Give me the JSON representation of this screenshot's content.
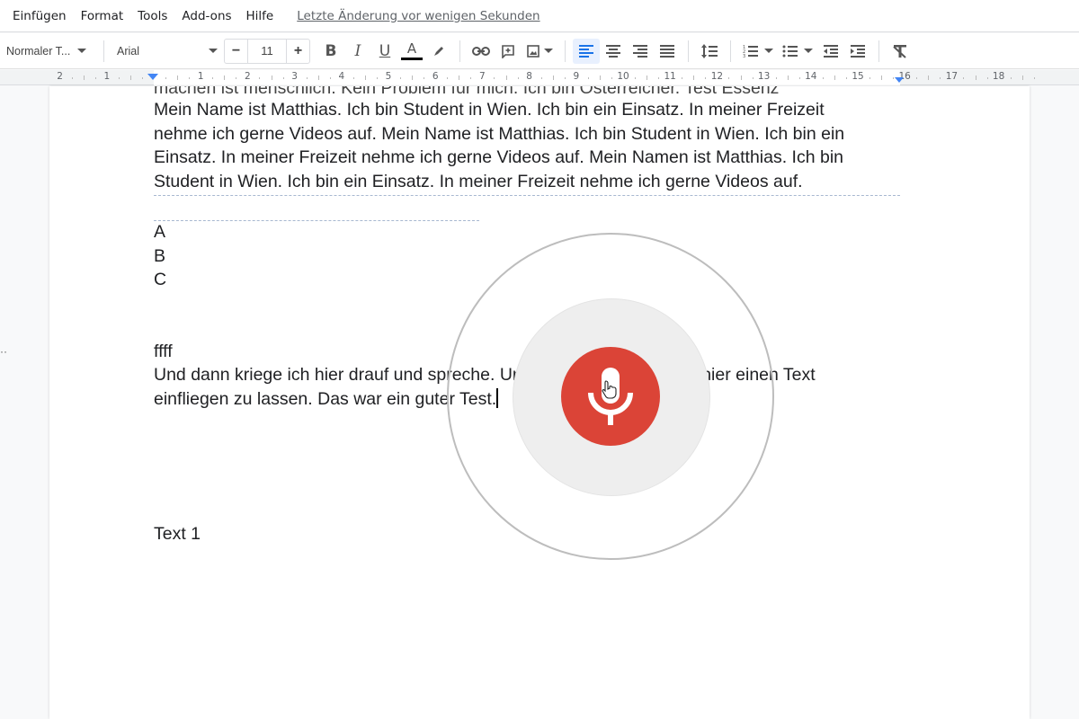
{
  "menubar": {
    "items": [
      "Einfügen",
      "Format",
      "Tools",
      "Add-ons",
      "Hilfe"
    ],
    "last_edit": "Letzte Änderung vor wenigen Sekunden"
  },
  "toolbar": {
    "paragraph_style": "Normaler T...",
    "font": "Arial",
    "font_size": "11",
    "decrease_label": "−",
    "increase_label": "+",
    "alignment_active": "left",
    "text_color": "#000000"
  },
  "ruler": {
    "left_numbers": [
      "2",
      "1"
    ],
    "right_numbers": [
      "1",
      "2",
      "3",
      "4",
      "5",
      "6",
      "7",
      "8",
      "9",
      "10",
      "11",
      "12",
      "13",
      "14",
      "15",
      "16",
      "17",
      "18"
    ]
  },
  "document": {
    "occluded_line": "machen ist menschlich. Kein Problem für mich. Ich bin Österreicher. Test Essenz",
    "paragraph1": "Mein Name ist Matthias. Ich bin Student in Wien. Ich bin ein Einsatz. In meiner Freizeit nehme ich gerne Videos auf. Mein Name ist Matthias. Ich bin Student in Wien. Ich bin ein Einsatz. In meiner Freizeit nehme ich gerne Videos auf. Mein Namen ist Matthias. Ich bin Student in Wien. Ich bin ein Einsatz. In meiner Freizeit nehme ich gerne Videos auf.",
    "list": [
      "A",
      "B",
      "C"
    ],
    "ffff": "ffff",
    "paragraph2": "Und dann kriege ich hier drauf und spreche. Und habe die Möglichkeit hier einen Text einfliegen zu lassen. Das war ein guter Test.",
    "text1": "Text 1"
  },
  "voice_typing": {
    "state": "listening",
    "mic_color": "#db4437"
  }
}
